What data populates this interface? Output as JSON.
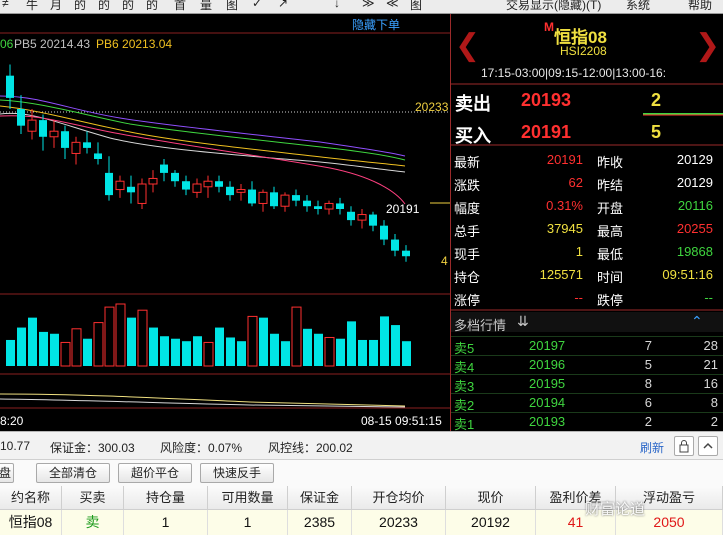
{
  "toolbar": {
    "items": [
      "≠",
      "牛",
      "月",
      "的",
      "的",
      "的",
      "首",
      "量",
      "图",
      "✓",
      "↗",
      "↓",
      "≫",
      "≪",
      "图"
    ],
    "right": [
      "交易显示(隐藏)(T)",
      "系统",
      "帮助"
    ]
  },
  "chart": {
    "hide_order_label": "隐藏下单",
    "ma_labels": [
      {
        "text": "06",
        "color": "#3fd53f"
      },
      {
        "text": "PB5 20214.43",
        "color": "#c0c0c0"
      },
      {
        "text": "PB6 20213.04",
        "color": "#f0c020"
      }
    ],
    "ref_price": "20233",
    "last_price": "20191",
    "right_mark": "4",
    "time_left": "8:20",
    "time_right": "08-15 09:51:15",
    "colors": {
      "up": "#ff3030",
      "down": "#00e5e5"
    },
    "candles": [
      {
        "t": "1",
        "o": 20240,
        "h": 20244,
        "l": 20228,
        "c": 20232
      },
      {
        "t": "2",
        "o": 20228,
        "h": 20233,
        "l": 20219,
        "c": 20222
      },
      {
        "t": "3",
        "o": 20220,
        "h": 20228,
        "l": 20217,
        "c": 20224
      },
      {
        "t": "4",
        "o": 20224,
        "h": 20226,
        "l": 20213,
        "c": 20218
      },
      {
        "t": "5",
        "o": 20218,
        "h": 20224,
        "l": 20214,
        "c": 20220
      },
      {
        "t": "6",
        "o": 20220,
        "h": 20222,
        "l": 20210,
        "c": 20214
      },
      {
        "t": "7",
        "o": 20212,
        "h": 20218,
        "l": 20208,
        "c": 20216
      },
      {
        "t": "8",
        "o": 20216,
        "h": 20220,
        "l": 20212,
        "c": 20214
      },
      {
        "t": "9",
        "o": 20212,
        "h": 20216,
        "l": 20208,
        "c": 20210
      },
      {
        "t": "10",
        "o": 20205,
        "h": 20211,
        "l": 20195,
        "c": 20197
      },
      {
        "t": "11",
        "o": 20199,
        "h": 20204,
        "l": 20196,
        "c": 20202
      },
      {
        "t": "12",
        "o": 20200,
        "h": 20204,
        "l": 20194,
        "c": 20198
      },
      {
        "t": "13",
        "o": 20194,
        "h": 20203,
        "l": 20192,
        "c": 20201
      },
      {
        "t": "14",
        "o": 20201,
        "h": 20206,
        "l": 20198,
        "c": 20203
      },
      {
        "t": "15",
        "o": 20208,
        "h": 20210,
        "l": 20202,
        "c": 20205
      },
      {
        "t": "16",
        "o": 20205,
        "h": 20206,
        "l": 20200,
        "c": 20202
      },
      {
        "t": "17",
        "o": 20202,
        "h": 20204,
        "l": 20197,
        "c": 20199
      },
      {
        "t": "18",
        "o": 20198,
        "h": 20203,
        "l": 20196,
        "c": 20201
      },
      {
        "t": "19",
        "o": 20200,
        "h": 20204,
        "l": 20196,
        "c": 20202
      },
      {
        "t": "20",
        "o": 20202,
        "h": 20204,
        "l": 20198,
        "c": 20200
      },
      {
        "t": "21",
        "o": 20200,
        "h": 20202,
        "l": 20195,
        "c": 20197
      },
      {
        "t": "22",
        "o": 20198,
        "h": 20201,
        "l": 20195,
        "c": 20199
      },
      {
        "t": "23",
        "o": 20199,
        "h": 20202,
        "l": 20193,
        "c": 20194
      },
      {
        "t": "24",
        "o": 20194,
        "h": 20199,
        "l": 20191,
        "c": 20198
      },
      {
        "t": "25",
        "o": 20198,
        "h": 20200,
        "l": 20192,
        "c": 20193
      },
      {
        "t": "26",
        "o": 20193,
        "h": 20198,
        "l": 20191,
        "c": 20197
      },
      {
        "t": "27",
        "o": 20197,
        "h": 20199,
        "l": 20193,
        "c": 20195
      },
      {
        "t": "28",
        "o": 20195,
        "h": 20197,
        "l": 20191,
        "c": 20193
      },
      {
        "t": "29",
        "o": 20193,
        "h": 20195,
        "l": 20190,
        "c": 20192
      },
      {
        "t": "30",
        "o": 20192,
        "h": 20195,
        "l": 20190,
        "c": 20194
      },
      {
        "t": "31",
        "o": 20194,
        "h": 20196,
        "l": 20190,
        "c": 20192
      },
      {
        "t": "32",
        "o": 20191,
        "h": 20193,
        "l": 20186,
        "c": 20188
      },
      {
        "t": "33",
        "o": 20188,
        "h": 20192,
        "l": 20185,
        "c": 20190
      },
      {
        "t": "34",
        "o": 20190,
        "h": 20191,
        "l": 20184,
        "c": 20186
      },
      {
        "t": "35",
        "o": 20186,
        "h": 20188,
        "l": 20179,
        "c": 20181
      },
      {
        "t": "36",
        "o": 20181,
        "h": 20183,
        "l": 20175,
        "c": 20177
      },
      {
        "t": "37",
        "o": 20177,
        "h": 20179,
        "l": 20173,
        "c": 20175
      }
    ],
    "volumes": [
      {
        "v": 0.42,
        "d": "down"
      },
      {
        "v": 0.62,
        "d": "down"
      },
      {
        "v": 0.78,
        "d": "down"
      },
      {
        "v": 0.55,
        "d": "down"
      },
      {
        "v": 0.52,
        "d": "down"
      },
      {
        "v": 0.38,
        "d": "up"
      },
      {
        "v": 0.6,
        "d": "up"
      },
      {
        "v": 0.44,
        "d": "down"
      },
      {
        "v": 0.7,
        "d": "up"
      },
      {
        "v": 0.95,
        "d": "up"
      },
      {
        "v": 1.0,
        "d": "up"
      },
      {
        "v": 0.78,
        "d": "down"
      },
      {
        "v": 0.9,
        "d": "up"
      },
      {
        "v": 0.62,
        "d": "down"
      },
      {
        "v": 0.48,
        "d": "down"
      },
      {
        "v": 0.44,
        "d": "down"
      },
      {
        "v": 0.4,
        "d": "down"
      },
      {
        "v": 0.48,
        "d": "down"
      },
      {
        "v": 0.38,
        "d": "up"
      },
      {
        "v": 0.62,
        "d": "down"
      },
      {
        "v": 0.46,
        "d": "down"
      },
      {
        "v": 0.4,
        "d": "down"
      },
      {
        "v": 0.8,
        "d": "up"
      },
      {
        "v": 0.78,
        "d": "down"
      },
      {
        "v": 0.52,
        "d": "down"
      },
      {
        "v": 0.4,
        "d": "down"
      },
      {
        "v": 0.95,
        "d": "up"
      },
      {
        "v": 0.6,
        "d": "down"
      },
      {
        "v": 0.52,
        "d": "down"
      },
      {
        "v": 0.46,
        "d": "up"
      },
      {
        "v": 0.44,
        "d": "down"
      },
      {
        "v": 0.72,
        "d": "down"
      },
      {
        "v": 0.42,
        "d": "down"
      },
      {
        "v": 0.42,
        "d": "down"
      },
      {
        "v": 0.8,
        "d": "down"
      },
      {
        "v": 0.66,
        "d": "down"
      },
      {
        "v": 0.4,
        "d": "down"
      }
    ]
  },
  "quote": {
    "title": "恒指08",
    "marker": "M",
    "code": "HSI2208",
    "sessions": "17:15-03:00|09:15-12:00|13:00-16:",
    "sell_label": "卖出",
    "sell_price": "20193",
    "sell_qty": "2",
    "buy_label": "买入",
    "buy_price": "20191",
    "buy_qty": "5",
    "rows": [
      {
        "l1": "最新",
        "v1": "20191",
        "c1": "#ff3030",
        "l2": "昨收",
        "v2": "20129",
        "c2": "#ffffff"
      },
      {
        "l1": "涨跌",
        "v1": "62",
        "c1": "#ff3030",
        "l2": "昨结",
        "v2": "20129",
        "c2": "#ffffff"
      },
      {
        "l1": "幅度",
        "v1": "0.31%",
        "c1": "#ff3030",
        "l2": "开盘",
        "v2": "20116",
        "c2": "#3fd53f"
      },
      {
        "l1": "总手",
        "v1": "37945",
        "c1": "#f0e040",
        "l2": "最高",
        "v2": "20255",
        "c2": "#ff3030"
      },
      {
        "l1": "现手",
        "v1": "1",
        "c1": "#f0e040",
        "l2": "最低",
        "v2": "19868",
        "c2": "#3fd53f"
      },
      {
        "l1": "持仓",
        "v1": "125571",
        "c1": "#f0e040",
        "l2": "时间",
        "v2": "09:51:16",
        "c2": "#f0e040"
      },
      {
        "l1": "涨停",
        "v1": "--",
        "c1": "#ff3030",
        "l2": "跌停",
        "v2": "--",
        "c2": "#3fd53f"
      }
    ],
    "depth_title": "多档行情",
    "depth": [
      {
        "label": "卖5",
        "price": "20197",
        "qty": "7",
        "extra": "28"
      },
      {
        "label": "卖4",
        "price": "20196",
        "qty": "5",
        "extra": "21"
      },
      {
        "label": "卖3",
        "price": "20195",
        "qty": "8",
        "extra": "16"
      },
      {
        "label": "卖2",
        "price": "20194",
        "qty": "6",
        "extra": "8"
      },
      {
        "label": "卖1",
        "price": "20193",
        "qty": "2",
        "extra": "2"
      }
    ]
  },
  "infobar": {
    "balance": "10.77",
    "margin": "保证金：300.03",
    "risk": "风险度：0.07%",
    "risk_line": "风控线：200.02",
    "refresh": "刷新"
  },
  "buttons": {
    "tab": "盘",
    "close_all": "全部清仓",
    "over_close": "超价平仓",
    "quick_reverse": "快速反手"
  },
  "table": {
    "headers": [
      "约名称",
      "买卖",
      "持仓量",
      "可用数量",
      "保证金",
      "开仓均价",
      "现价",
      "盈利价差",
      "浮动盈亏"
    ],
    "row": [
      "恒指08",
      "卖",
      "1",
      "1",
      "2385",
      "20233",
      "20192",
      "41",
      "2050"
    ],
    "row_colors": [
      "#111111",
      "#1a9a1a",
      "#111111",
      "#111111",
      "#111111",
      "#111111",
      "#111111",
      "#e01818",
      "#e01818"
    ]
  },
  "watermark": "财富论道"
}
